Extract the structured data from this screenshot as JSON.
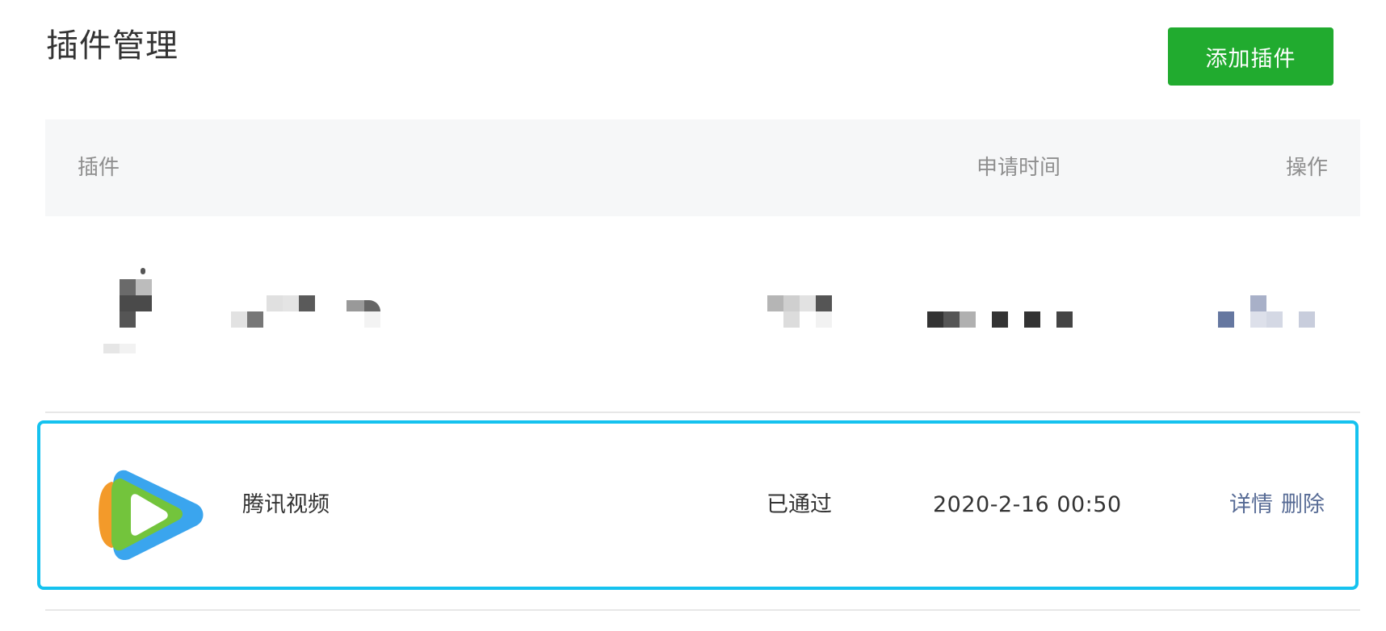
{
  "page": {
    "title": "插件管理",
    "add_button_label": "添加插件"
  },
  "table": {
    "headers": {
      "plugin": "插件",
      "apply_time": "申请时间",
      "operations": "操作"
    },
    "rows": [
      {
        "redacted": true
      },
      {
        "redacted": false,
        "icon": "tencent-video-logo-icon",
        "name": "腾讯视频",
        "status": "已通过",
        "apply_time": "2020-2-16 00:50",
        "actions": [
          "详情",
          "删除"
        ],
        "highlighted": true
      }
    ]
  },
  "colors": {
    "primary_button": "#21ab2f",
    "highlight_border": "#15c2ef",
    "link": "#576b95",
    "header_bg": "#f6f7f8",
    "header_text": "#8f8f8f"
  }
}
